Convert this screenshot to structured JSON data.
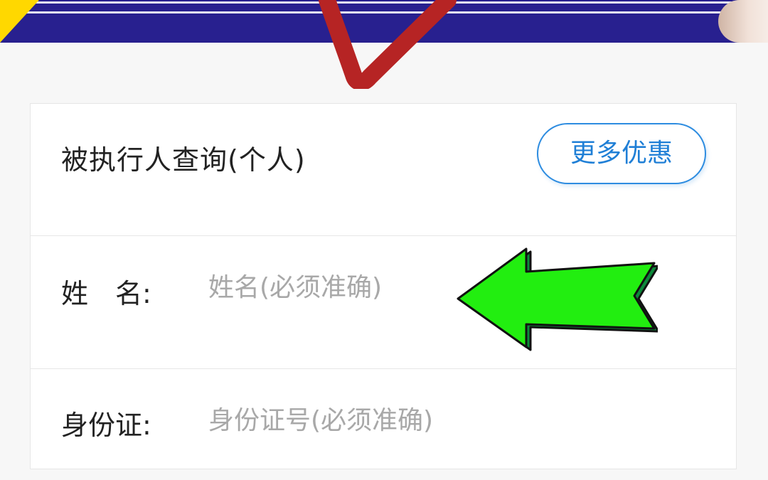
{
  "form": {
    "title": "被执行人查询(个人)",
    "more_button_label": "更多优惠",
    "name_label": "姓　名:",
    "name_placeholder": "姓名(必须准确)",
    "name_value": "",
    "id_label": "身份证:",
    "id_placeholder": "身份证号(必须准确)",
    "id_value": ""
  },
  "colors": {
    "banner": "#28208f",
    "accent": "#2d8ce0",
    "arrow_fill": "#22ee10",
    "checkmark": "#b62424"
  },
  "icons": {
    "checkmark": "red-checkmark-icon",
    "arrow": "green-left-arrow-icon"
  }
}
